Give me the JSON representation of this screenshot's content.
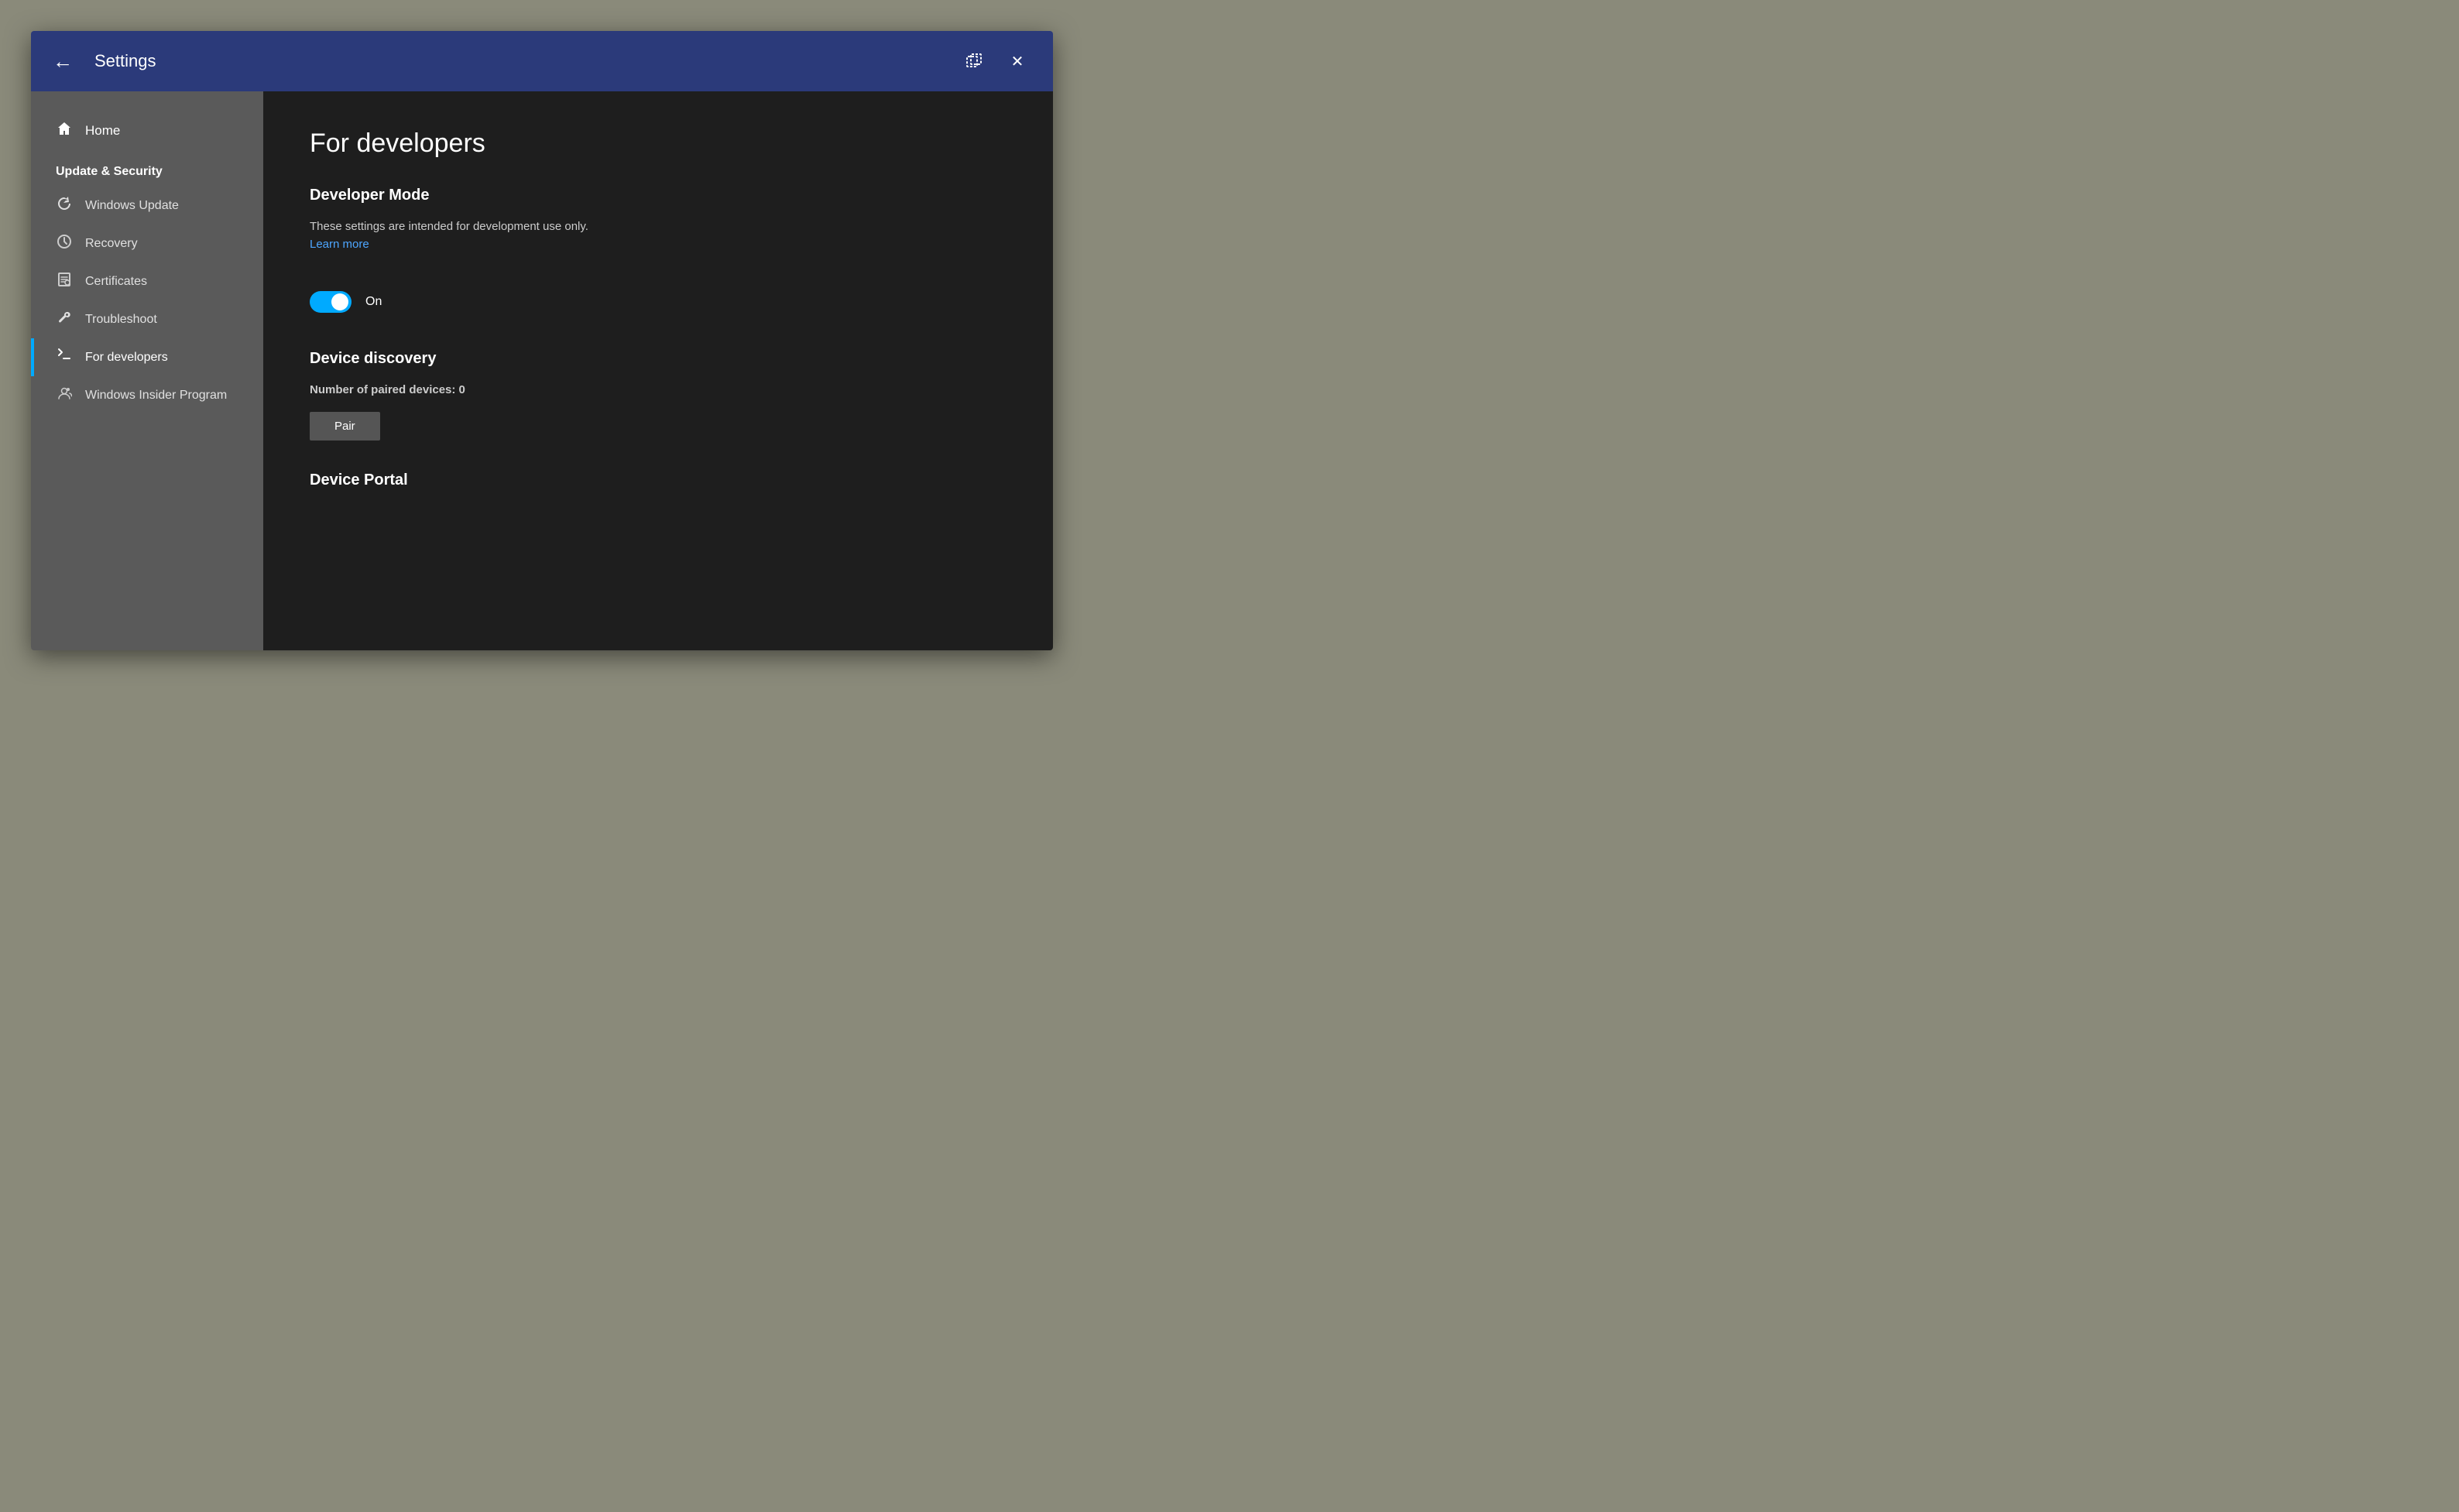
{
  "titlebar": {
    "back_label": "←",
    "title": "Settings",
    "restore_label": "❐",
    "close_label": "✕"
  },
  "sidebar": {
    "home_label": "Home",
    "section_title": "Update & Security",
    "items": [
      {
        "id": "windows-update",
        "label": "Windows Update",
        "icon": "update"
      },
      {
        "id": "recovery",
        "label": "Recovery",
        "icon": "recovery"
      },
      {
        "id": "certificates",
        "label": "Certificates",
        "icon": "certificates"
      },
      {
        "id": "troubleshoot",
        "label": "Troubleshoot",
        "icon": "troubleshoot"
      },
      {
        "id": "for-developers",
        "label": "For developers",
        "icon": "developers",
        "active": true
      },
      {
        "id": "windows-insider",
        "label": "Windows Insider Program",
        "icon": "insider"
      }
    ]
  },
  "main": {
    "page_title": "For developers",
    "developer_mode": {
      "section_title": "Developer Mode",
      "description": "These settings are intended for development use only.",
      "learn_more": "Learn more",
      "toggle_state": "On"
    },
    "device_discovery": {
      "section_title": "Device discovery",
      "paired_devices_text": "Number of paired devices: 0",
      "pair_button_label": "Pair"
    },
    "device_portal": {
      "section_title": "Device Portal"
    }
  }
}
